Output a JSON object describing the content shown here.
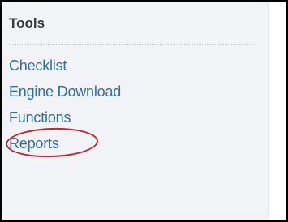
{
  "tools_panel": {
    "title": "Tools",
    "items": [
      {
        "label": "Checklist"
      },
      {
        "label": "Engine Download"
      },
      {
        "label": "Functions"
      },
      {
        "label": "Reports"
      }
    ]
  },
  "annotation": {
    "circled_item": "Reports",
    "color": "#c1282e"
  },
  "colors": {
    "link": "#2f6fa7",
    "panel_background": "#f1f3f6",
    "border": "#000000"
  }
}
